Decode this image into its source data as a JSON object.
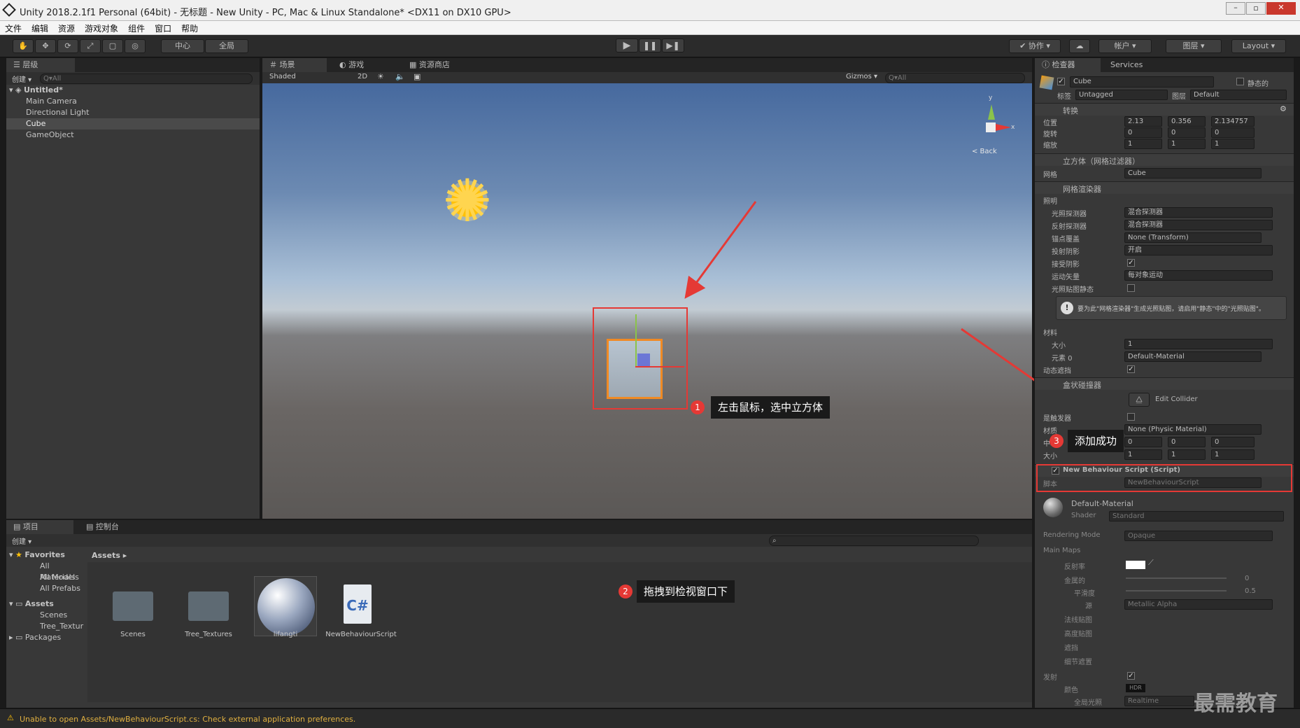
{
  "window": {
    "title": "Unity 2018.2.1f1 Personal (64bit) - 无标题 - New Unity - PC, Mac & Linux Standalone* <DX11 on DX10 GPU>"
  },
  "menu": [
    "文件",
    "编辑",
    "资源",
    "游戏对象",
    "组件",
    "窗口",
    "帮助"
  ],
  "toolbar": {
    "pivot": "中心",
    "space": "全局",
    "collab": "协作",
    "account": "帐户",
    "layers": "图层",
    "layout": "Layout"
  },
  "hierarchy": {
    "tab": "层级",
    "create": "创建",
    "search_placeholder": "Q▾All",
    "scene": "Untitled*",
    "items": [
      "Main Camera",
      "Directional Light",
      "Cube",
      "GameObject"
    ]
  },
  "scene_view": {
    "tabs": [
      "场景",
      "游戏",
      "资源商店"
    ],
    "shading": "Shaded",
    "mode_2d": "2D",
    "gizmos": "Gizmos",
    "search_placeholder": "Q▾All",
    "back": "< Back",
    "axis_x": "x",
    "axis_y": "y"
  },
  "inspector": {
    "tabs": [
      "检查器",
      "Services"
    ],
    "object_name": "Cube",
    "static": "静态的",
    "tag_label": "标签",
    "tag": "Untagged",
    "layer_label": "图层",
    "layer": "Default",
    "transform": {
      "title": "转换",
      "rows": [
        {
          "label": "位置",
          "x": "2.13",
          "y": "0.356",
          "z": "2.134757"
        },
        {
          "label": "旋转",
          "x": "0",
          "y": "0",
          "z": "0"
        },
        {
          "label": "缩放",
          "x": "1",
          "y": "1",
          "z": "1"
        }
      ]
    },
    "mesh_filter": {
      "title": "立方体（网格过滤器）",
      "mesh_label": "网格",
      "mesh": "Cube"
    },
    "mesh_renderer": {
      "title": "网格渲染器",
      "lighting": "照明",
      "rows": [
        {
          "label": "光照探测器",
          "value": "混合探测器"
        },
        {
          "label": "反射探测器",
          "value": "混合探测器"
        },
        {
          "label": "锚点覆盖",
          "value": "None (Transform)"
        },
        {
          "label": "投射阴影",
          "value": "开启"
        },
        {
          "label": "接受阴影",
          "value": "✓"
        },
        {
          "label": "运动矢量",
          "value": "每对象运动"
        },
        {
          "label": "光照贴图静态",
          "value": ""
        }
      ],
      "info": "要为此\"网格渲染器\"生成光照贴图，请启用\"静态\"中的\"光照贴图\"。",
      "materials": "材料",
      "size_label": "大小",
      "size": "1",
      "element_label": "元素 0",
      "element": "Default-Material",
      "dynamic_occluded": "动态遮挡"
    },
    "box_collider": {
      "title": "盒状碰撞器",
      "edit": "Edit Collider",
      "trigger": "是触发器",
      "material_label": "材质",
      "material": "None (Physic Material)",
      "center_label": "中心",
      "center": {
        "x": "0",
        "y": "0",
        "z": "0"
      },
      "size_label": "大小",
      "size": {
        "x": "1",
        "y": "1",
        "z": "1"
      }
    },
    "script": {
      "title": "New Behaviour Script (Script)",
      "label": "脚本",
      "value": "NewBehaviourScript"
    },
    "material": {
      "name": "Default-Material",
      "shader_label": "Shader",
      "shader": "Standard",
      "rendering_mode_label": "Rendering Mode",
      "rendering_mode": "Opaque",
      "main_maps": "Main Maps",
      "albedo": "反射率",
      "metallic": "金属的",
      "metallic_value": "0",
      "smoothness": "平滑度",
      "smoothness_value": "0.5",
      "source": "源",
      "source_value": "Metallic Alpha",
      "normal": "法线贴图",
      "height": "高度贴图",
      "occlusion": "遮挡",
      "detail_mask": "细节遮置",
      "emission": "发射",
      "color": "颜色",
      "hdr": "HDR",
      "gi_label": "全局光照",
      "gi": "Realtime"
    }
  },
  "project": {
    "tabs": [
      "项目",
      "控制台"
    ],
    "create": "创建",
    "favorites": "Favorites",
    "fav_items": [
      "All Materials",
      "All Models",
      "All Prefabs"
    ],
    "assets": "Assets",
    "asset_folders": [
      "Scenes",
      "Tree_Textur"
    ],
    "packages": "Packages",
    "breadcrumb": "Assets ▸",
    "items": [
      "Scenes",
      "Tree_Textures",
      "lifangti",
      "NewBehaviourScript"
    ],
    "cs_glyph": "C#"
  },
  "status": "Unable to open Assets/NewBehaviourScript.cs: Check external application preferences.",
  "annotations": [
    {
      "num": "1",
      "text": "左击鼠标，选中立方体"
    },
    {
      "num": "2",
      "text": "拖拽到检视窗口下"
    },
    {
      "num": "3",
      "text": "添加成功"
    }
  ],
  "watermark": "最需教育",
  "colors": {
    "accent_red": "#e53935",
    "selection_orange": "#f08a24",
    "panel": "#383838"
  }
}
